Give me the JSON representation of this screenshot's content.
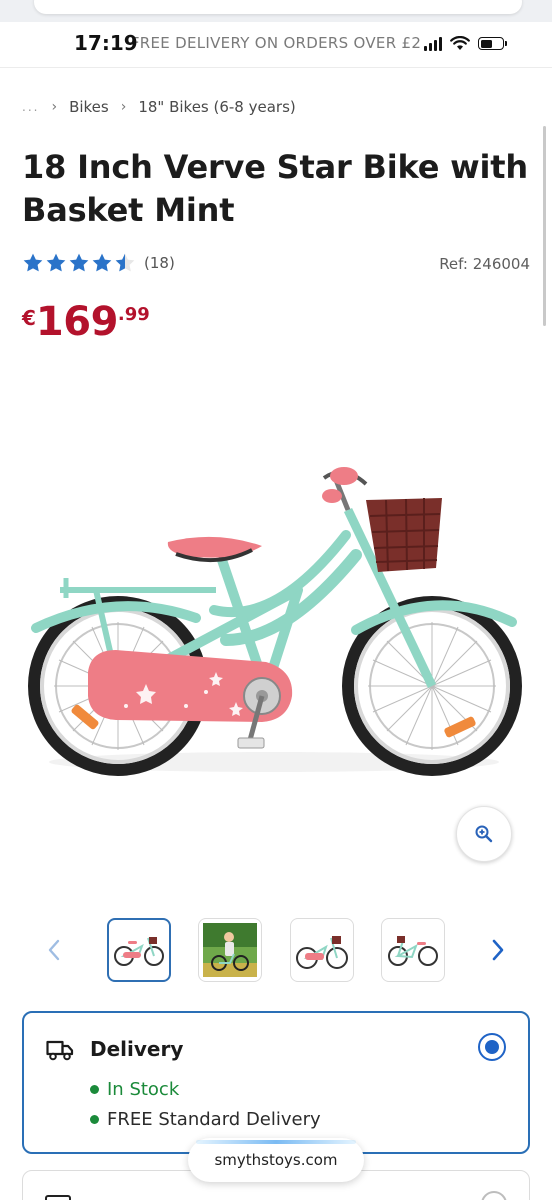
{
  "status_bar": {
    "time": "17:19",
    "promo": "FREE DELIVERY ON ORDERS OVER £2"
  },
  "breadcrumb": {
    "ellipsis": "...",
    "items": [
      "Bikes",
      "18\" Bikes (6-8 years)"
    ]
  },
  "product": {
    "title": "18 Inch Verve Star Bike with Basket Mint",
    "rating": 4.5,
    "rating_max": 5,
    "review_count": "(18)",
    "ref": "Ref: 246004",
    "price_currency": "€",
    "price_whole": "169",
    "price_cents": ".99"
  },
  "gallery": {
    "thumbnail_count": 4,
    "active_index": 0
  },
  "delivery": {
    "title": "Delivery",
    "selected": true,
    "stock_status": "In Stock",
    "delivery_note": "FREE Standard Delivery"
  },
  "browser": {
    "url": "smythstoys.com"
  },
  "colors": {
    "price_red": "#b3122c",
    "star_blue": "#2a73c9",
    "selection_blue": "#1f63c6",
    "stock_green": "#1b8a3a",
    "bike_mint": "#8fd6c4",
    "bike_pink": "#ee7d86"
  }
}
